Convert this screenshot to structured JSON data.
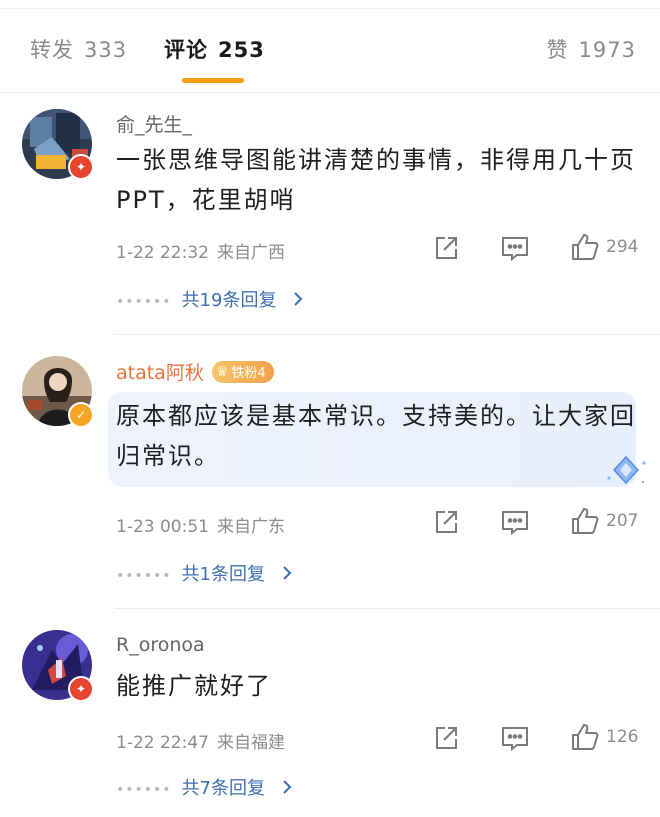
{
  "tabs": {
    "forward_label": "转发",
    "forward_count": "333",
    "comment_label": "评论",
    "comment_count": "253",
    "like_label": "赞",
    "like_count": "1973"
  },
  "comments": [
    {
      "username": "俞_先生_",
      "text": "一张思维导图能讲清楚的事情，非得用几十页PPT，花里胡哨",
      "time": "1-22 22:32",
      "location": "来自广西",
      "likes": "294",
      "replies": "共19条回复"
    },
    {
      "username": "atata阿秋",
      "fan_badge": "铁粉4",
      "text": "原本都应该是基本常识。支持美的。让大家回归常识。",
      "time": "1-23 00:51",
      "location": "来自广东",
      "likes": "207",
      "replies": "共1条回复"
    },
    {
      "username": "R_oronoa",
      "text": "能推广就好了",
      "time": "1-22 22:47",
      "location": "来自福建",
      "likes": "126",
      "replies": "共7条回复"
    }
  ],
  "icons": {
    "share": "share-icon",
    "comment": "comment-icon",
    "like": "thumbs-up-icon",
    "chevron": "chevron-right-icon",
    "vip": "vip-badge-icon",
    "verified": "verified-badge-icon"
  },
  "colors": {
    "accent": "#f39c12",
    "link": "#3f6fb0",
    "vip_red": "#e8432e",
    "username_orange": "#e8743c"
  }
}
